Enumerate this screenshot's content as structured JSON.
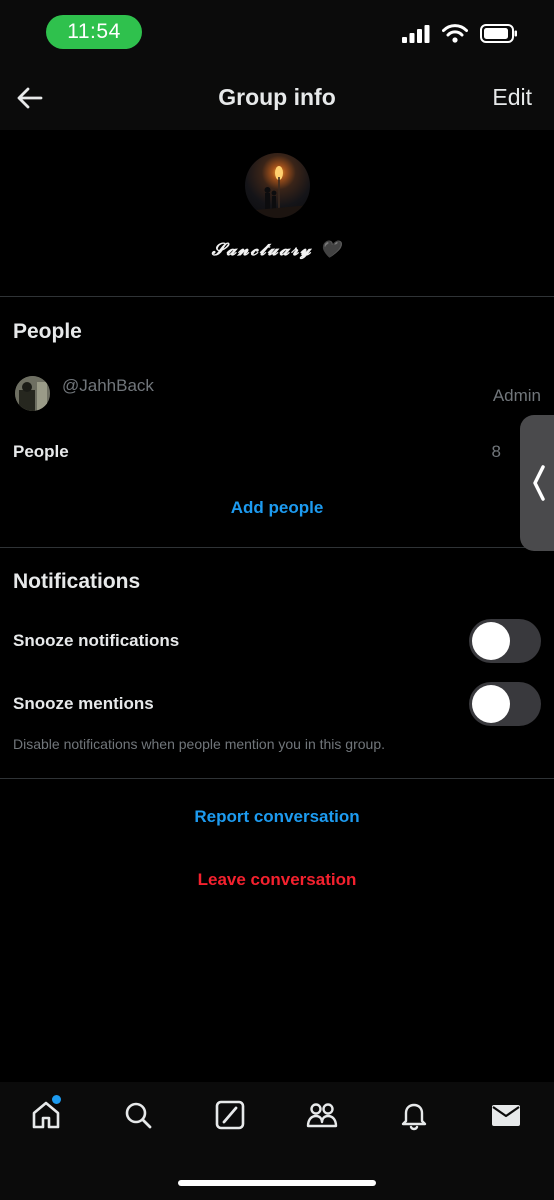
{
  "status_bar": {
    "time": "11:54",
    "time_pill_color": "#2fc14d"
  },
  "header": {
    "title": "Group info",
    "edit_label": "Edit",
    "back_icon": "arrow-left-icon"
  },
  "group": {
    "name": "𝓢𝓪𝓷𝓬𝓽𝓾𝓪𝓻𝔂 🖤"
  },
  "people_section": {
    "title": "People",
    "members": [
      {
        "handle": "@JahhBack",
        "role": "Admin"
      }
    ],
    "people_label": "People",
    "people_count": "8",
    "add_people_label": "Add people"
  },
  "notifications_section": {
    "title": "Notifications",
    "snooze_notifications_label": "Snooze notifications",
    "snooze_notifications_on": false,
    "snooze_mentions_label": "Snooze mentions",
    "snooze_mentions_on": false,
    "mentions_hint": "Disable notifications when people mention you in this group."
  },
  "actions": {
    "report_label": "Report conversation",
    "leave_label": "Leave conversation"
  },
  "bottom_nav": {
    "items": [
      "home-icon",
      "search-icon",
      "grok-icon",
      "communities-icon",
      "notifications-bell-icon",
      "messages-envelope-icon"
    ],
    "home_has_badge": true
  },
  "colors": {
    "accent": "#1d9bf0",
    "danger": "#f4212e",
    "background": "#000000"
  }
}
